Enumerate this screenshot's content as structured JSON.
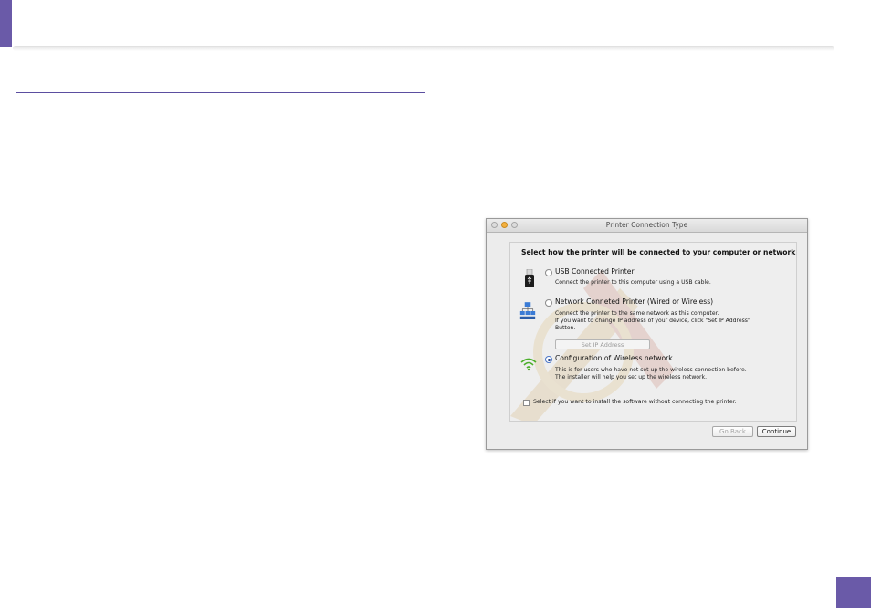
{
  "window": {
    "title": "Printer Connection Type"
  },
  "dialog": {
    "heading": "Select how the printer will be connected to your computer or network.",
    "options": [
      {
        "icon": "usb-icon",
        "label": "USB Connected Printer",
        "selected": false,
        "description": [
          "Connect the printer to this computer using a USB cable."
        ]
      },
      {
        "icon": "network-icon",
        "label": "Network Conneted Printer (Wired or Wireless)",
        "selected": false,
        "description": [
          "Connect the printer to the same network as this computer.",
          "If you want to change IP address of your device, click \"Set IP Address\"",
          "Button."
        ],
        "button": "Set IP Address"
      },
      {
        "icon": "wifi-icon",
        "label": "Configuration of Wireless network",
        "selected": true,
        "description": [
          "This is for users who have not set up the wireless connection before.",
          "The installer will help you set up the wireless network."
        ]
      }
    ],
    "checkbox_label": "Select if you want to install the software without connecting the printer.",
    "checkbox_checked": false
  },
  "buttons": {
    "back": "Go Back",
    "continue": "Continue"
  },
  "colors": {
    "accent": "#6a5aa8",
    "radio_selected": "#1f3f88"
  }
}
